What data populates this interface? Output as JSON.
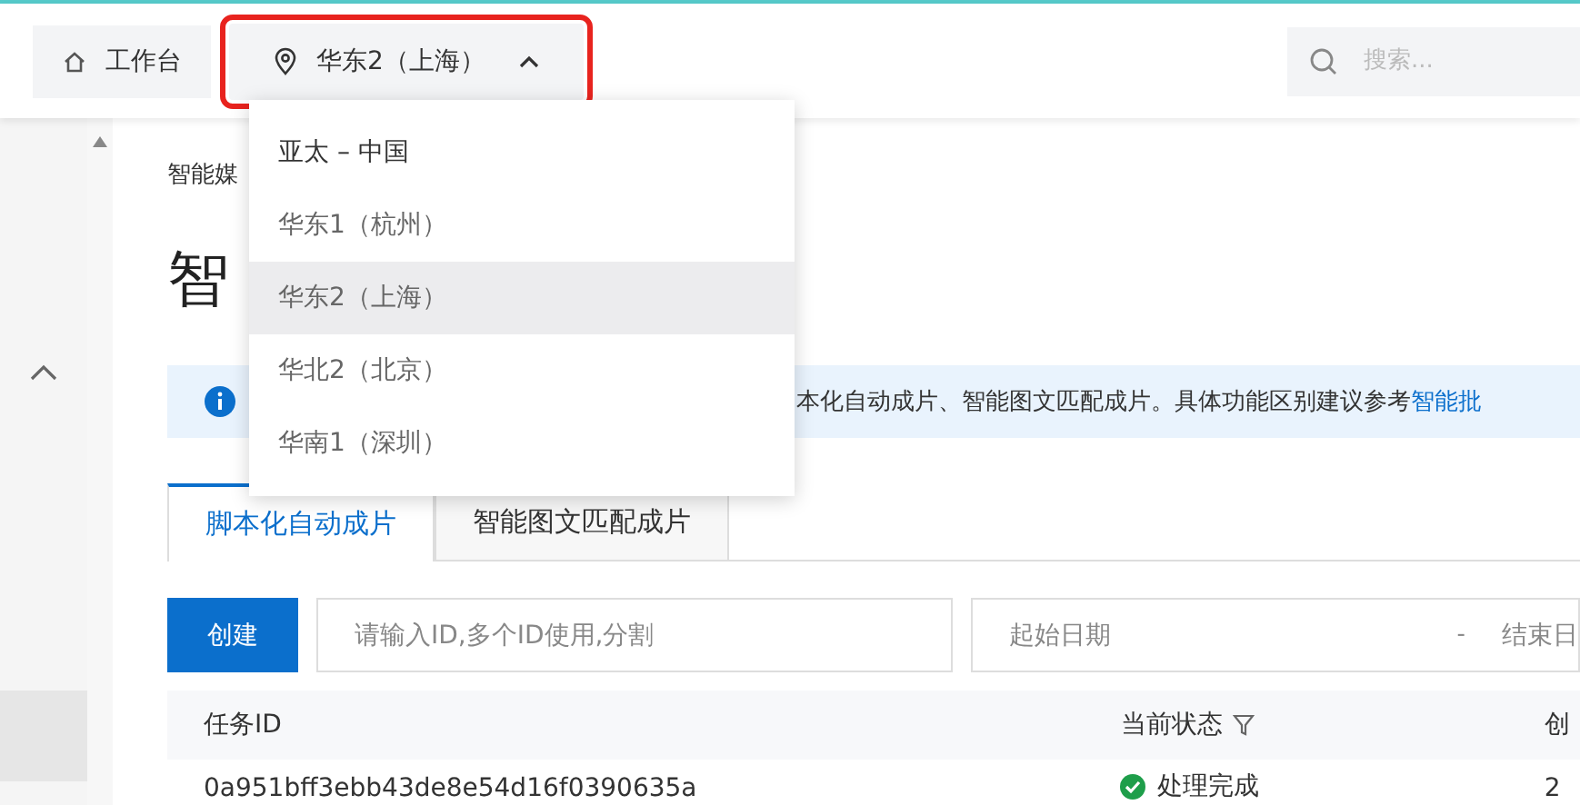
{
  "topbar": {
    "home": {
      "label": "工作台"
    },
    "region": {
      "label": "华东2（上海）",
      "expanded": true,
      "highlighted": true
    },
    "search": {
      "placeholder": "搜索..."
    }
  },
  "region_menu": [
    {
      "label": "亚太 – 中国",
      "selected": false,
      "kind": "group"
    },
    {
      "label": "华东1（杭州）",
      "selected": false,
      "kind": "option"
    },
    {
      "label": "华东2（上海）",
      "selected": true,
      "kind": "option"
    },
    {
      "label": "华北2（北京）",
      "selected": false,
      "kind": "option"
    },
    {
      "label": "华南1（深圳）",
      "selected": false,
      "kind": "option"
    }
  ],
  "breadcrumb": "智能媒",
  "page_title": "智",
  "notice": {
    "text": "本化自动成片、智能图文匹配成片。具体功能区别建议参考 ",
    "link": "智能批"
  },
  "tabs": [
    {
      "label": "脚本化自动成片",
      "selected": true
    },
    {
      "label": "智能图文匹配成片",
      "selected": false
    }
  ],
  "toolbar": {
    "create": "创建",
    "id_field": {
      "placeholder": "请输入ID,多个ID使用,分割"
    },
    "date_range": {
      "start_placeholder": "起始日期",
      "separator": "-",
      "end_placeholder": "结束日"
    }
  },
  "table": {
    "columns": [
      "任务ID",
      "当前状态",
      "创"
    ],
    "rows": [
      {
        "cells": [
          "0a951bff3ebb43de8e54d16f0390635a",
          "处理完成",
          "2"
        ],
        "kind": "done"
      }
    ]
  }
}
